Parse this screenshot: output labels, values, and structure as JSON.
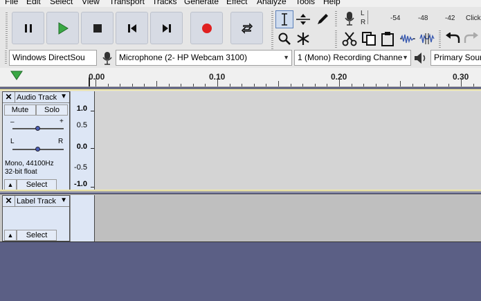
{
  "menu": [
    "File",
    "Edit",
    "Select",
    "View",
    "Transport",
    "Tracks",
    "Generate",
    "Effect",
    "Analyze",
    "Tools",
    "Help"
  ],
  "meter": {
    "l_label": "L",
    "r_label": "R",
    "scale": [
      "-54",
      "-48",
      "-42"
    ],
    "click_hint": "Click"
  },
  "devices": {
    "host": "Windows DirectSou",
    "recording_device": "Microphone (2- HP Webcam 3100)",
    "channels": "1 (Mono) Recording Channe",
    "playback_device": "Primary Sour"
  },
  "ruler": {
    "labels": [
      "0.00",
      "0.10",
      "0.20",
      "0.30"
    ]
  },
  "audio_track": {
    "name": "Audio Track",
    "mute": "Mute",
    "solo": "Solo",
    "gain_minus": "–",
    "gain_plus": "+",
    "pan_left": "L",
    "pan_right": "R",
    "format_line1": "Mono, 44100Hz",
    "format_line2": "32-bit float",
    "select": "Select",
    "scale": [
      "1.0",
      "0.5",
      "0.0",
      "-0.5",
      "-1.0"
    ]
  },
  "label_track": {
    "name": "Label Track",
    "select": "Select"
  },
  "colors": {
    "background": "#5b5f85",
    "track_panel": "#dde6f5",
    "audio_wave_bg": "#d4d4d4",
    "label_wave_bg": "#bfbfbf",
    "play_green": "#3aa845",
    "record_red": "#e02020"
  }
}
